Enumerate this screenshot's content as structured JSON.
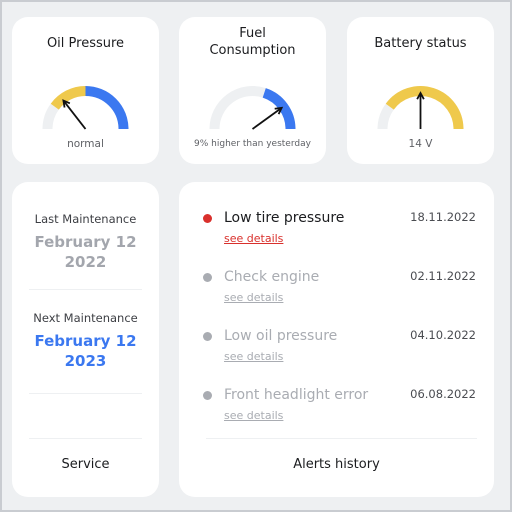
{
  "colors": {
    "track": "#eef0f2",
    "yellow": "#efc94c",
    "blue": "#3b78f0",
    "needle": "#111111",
    "alert_active": "#d9302c",
    "alert_inactive": "#a9acb2",
    "next_date": "#3b78f0",
    "past_date": "#a3a6ad"
  },
  "gauges": {
    "oil": {
      "title": "Oil Pressure",
      "caption": "normal",
      "needle_fraction": 0.29,
      "segments": [
        {
          "from": 0.0,
          "to": 0.2,
          "color": "track"
        },
        {
          "from": 0.2,
          "to": 0.5,
          "color": "yellow"
        },
        {
          "from": 0.5,
          "to": 1.0,
          "color": "blue"
        }
      ]
    },
    "fuel": {
      "title_line1": "Fuel",
      "title_line2": "Consumption",
      "caption": "9% higher than yesterday",
      "needle_fraction": 0.8,
      "segments": [
        {
          "from": 0.0,
          "to": 0.6,
          "color": "track"
        },
        {
          "from": 0.6,
          "to": 1.0,
          "color": "blue"
        }
      ]
    },
    "battery": {
      "title": "Battery status",
      "caption": "14 V",
      "needle_fraction": 0.5,
      "segments": [
        {
          "from": 0.0,
          "to": 0.2,
          "color": "track"
        },
        {
          "from": 0.2,
          "to": 1.0,
          "color": "yellow"
        }
      ]
    }
  },
  "maintenance": {
    "last_label": "Last Maintenance",
    "last_date_line1": "February 12",
    "last_date_line2": "2022",
    "next_label": "Next Maintenance",
    "next_date_line1": "February 12",
    "next_date_line2": "2023",
    "footer_button": "Service"
  },
  "alerts": {
    "items": [
      {
        "title": "Low tire pressure",
        "date": "18.11.2022",
        "link": "see details",
        "status": "active"
      },
      {
        "title": "Check engine",
        "date": "02.11.2022",
        "link": "see details",
        "status": "inactive"
      },
      {
        "title": "Low oil pressure",
        "date": "04.10.2022",
        "link": "see details",
        "status": "inactive"
      },
      {
        "title": "Front headlight error",
        "date": "06.08.2022",
        "link": "see details",
        "status": "inactive"
      }
    ],
    "footer_button": "Alerts history"
  }
}
